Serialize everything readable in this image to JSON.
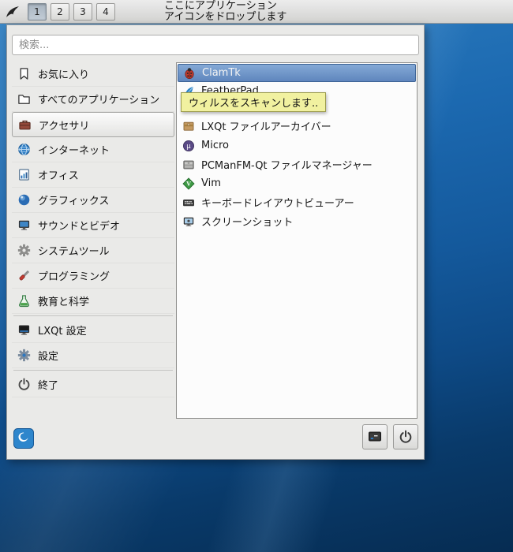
{
  "panel": {
    "menu_button_icon": "bird-icon",
    "workspaces": [
      {
        "label": "1",
        "active": true
      },
      {
        "label": "2",
        "active": false
      },
      {
        "label": "3",
        "active": false
      },
      {
        "label": "4",
        "active": false
      }
    ],
    "drop_hint_line1": "ここにアプリケーション",
    "drop_hint_line2": "アイコンをドロップします"
  },
  "menu": {
    "search_placeholder": "検索...",
    "categories": [
      {
        "label": "お気に入り",
        "icon": "bookmark-icon",
        "selected": false
      },
      {
        "label": "すべてのアプリケーション",
        "icon": "folder-icon",
        "selected": false
      },
      {
        "label": "アクセサリ",
        "icon": "briefcase-icon",
        "selected": true
      },
      {
        "label": "インターネット",
        "icon": "globe-icon",
        "selected": false
      },
      {
        "label": "オフィス",
        "icon": "office-chart-icon",
        "selected": false
      },
      {
        "label": "グラフィックス",
        "icon": "sphere-icon",
        "selected": false
      },
      {
        "label": "サウンドとビデオ",
        "icon": "monitor-media-icon",
        "selected": false
      },
      {
        "label": "システムツール",
        "icon": "gear-icon",
        "selected": false
      },
      {
        "label": "プログラミング",
        "icon": "screwdriver-icon",
        "selected": false
      },
      {
        "label": "教育と科学",
        "icon": "flask-icon",
        "selected": false
      },
      {
        "label": "LXQt 設定",
        "icon": "monitor-settings-icon",
        "selected": false
      },
      {
        "label": "設定",
        "icon": "gear-blue-icon",
        "selected": false
      },
      {
        "label": "終了",
        "icon": "power-icon",
        "selected": false
      }
    ],
    "apps": [
      {
        "label": "ClamTk",
        "icon": "bug-icon",
        "selected": true
      },
      {
        "label": "FeatherPad",
        "icon": "feather-icon",
        "selected": false
      },
      {
        "label": "LXQt ファイルアーカイバー",
        "icon": "archive-box-icon",
        "selected": false
      },
      {
        "label": "Micro",
        "icon": "mu-circle-icon",
        "selected": false
      },
      {
        "label": "PCManFM-Qt ファイルマネージャー",
        "icon": "file-cabinet-icon",
        "selected": false
      },
      {
        "label": "Vim",
        "icon": "vim-diamond-icon",
        "selected": false
      },
      {
        "label": "キーボードレイアウトビューアー",
        "icon": "keyboard-icon",
        "selected": false
      },
      {
        "label": "スクリーンショット",
        "icon": "screenshot-monitor-icon",
        "selected": false
      }
    ],
    "tooltip_text": "ウィルスをスキャンします.."
  },
  "footer": {
    "logo_icon": "lxqt-logo-icon",
    "buttons": [
      {
        "icon": "leave-screen-icon"
      },
      {
        "icon": "power-icon"
      }
    ]
  },
  "colors": {
    "selection_blue": "#5f86bd",
    "tooltip_yellow": "#f1f1a0",
    "panel_gray": "#d2d2d0",
    "menu_bg": "#eaeae8",
    "desktop_blue": "#14599c"
  }
}
